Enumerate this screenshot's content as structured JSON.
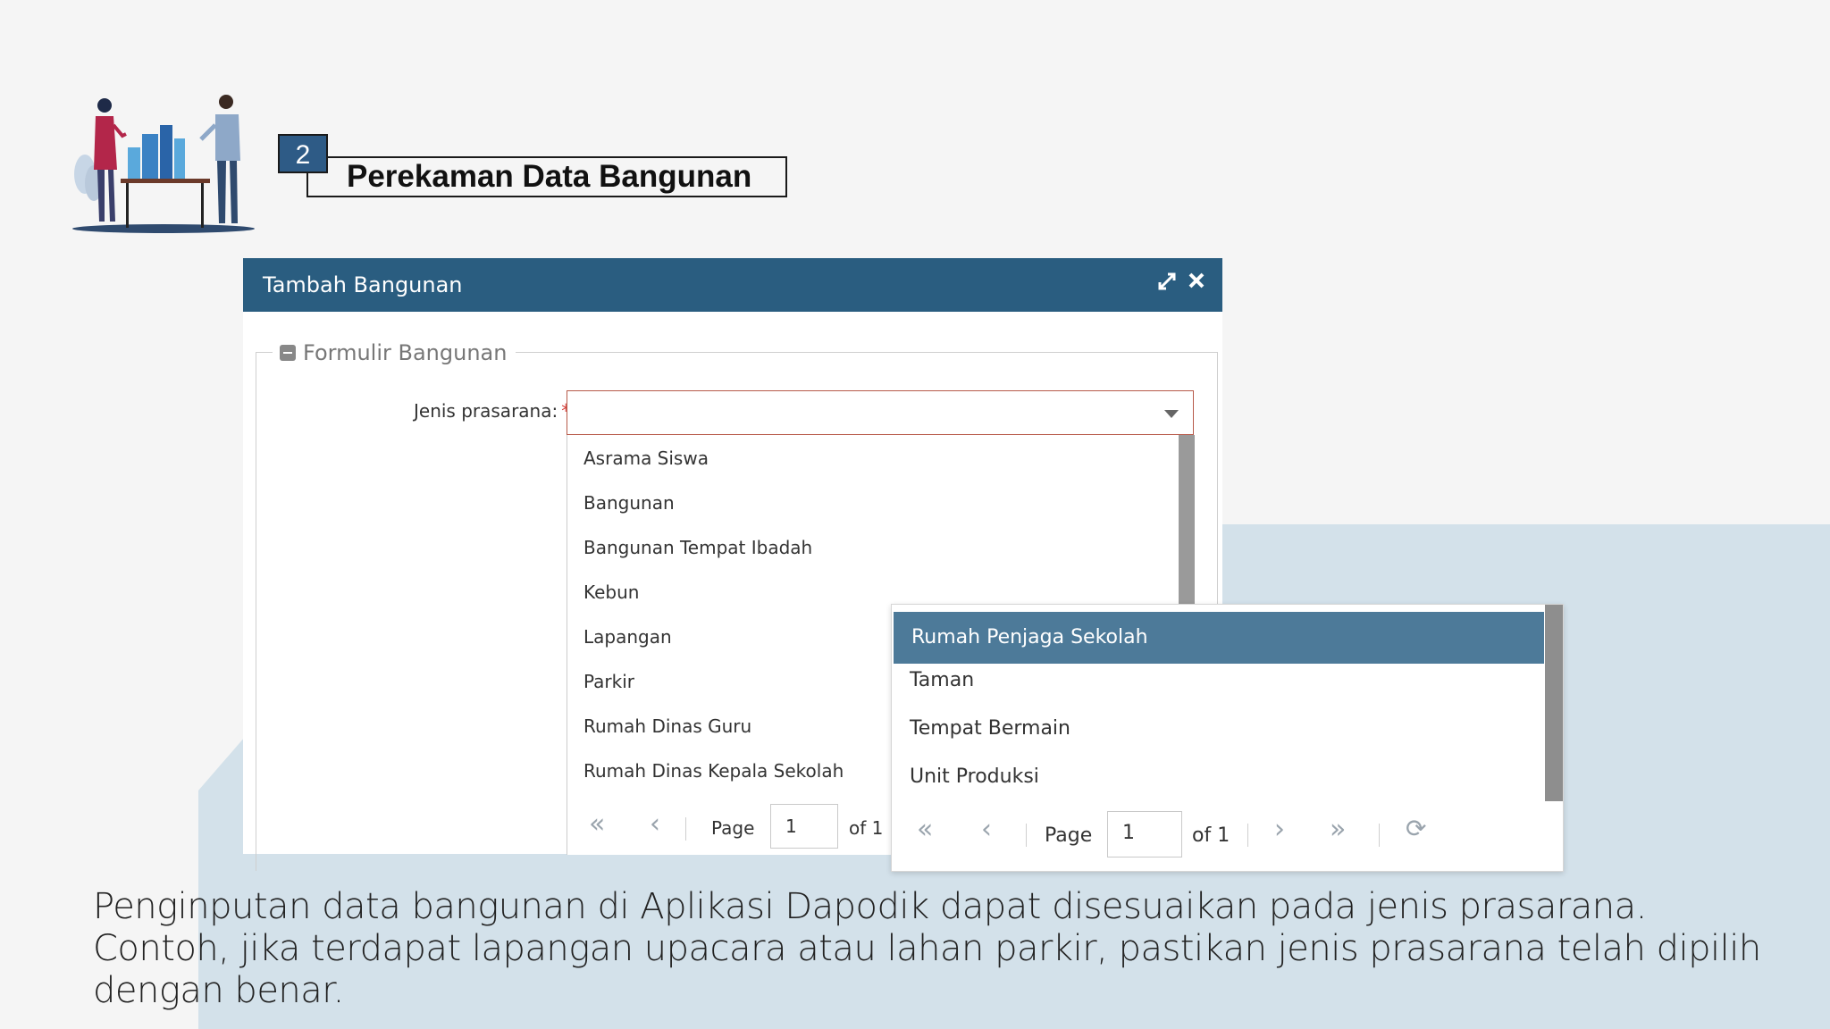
{
  "slide": {
    "step_number": "2",
    "title": "Perekaman Data Bangunan",
    "caption": "Penginputan data bangunan di Aplikasi Dapodik dapat disesuaikan pada jenis prasarana. Contoh, jika terdapat lapangan upacara atau lahan parkir, pastikan jenis prasarana telah dipilih dengan benar."
  },
  "dialog": {
    "title": "Tambah Bangunan",
    "icons": [
      "maximize-icon",
      "close-icon"
    ],
    "fieldset_legend": "Formulir Bangunan",
    "field": {
      "label": "Jenis prasarana:",
      "required_marker": "*",
      "value": ""
    }
  },
  "dropdown_list": {
    "items": [
      "Asrama Siswa",
      "Bangunan",
      "Bangunan Tempat Ibadah",
      "Kebun",
      "Lapangan",
      "Parkir",
      "Rumah Dinas Guru",
      "Rumah Dinas Kepala Sekolah"
    ],
    "pager": {
      "page_label": "Page",
      "page_value": "1",
      "of_label": "of 1"
    }
  },
  "dropdown_list_zoom": {
    "selected": "Rumah Penjaga Sekolah",
    "items": [
      "Taman",
      "Tempat Bermain",
      "Unit Produksi"
    ],
    "pager": {
      "page_label": "Page",
      "page_value": "1",
      "of_label": "of 1"
    }
  },
  "colors": {
    "header": "#2a5d80",
    "selected_row": "#4d7a99",
    "badge": "#2e5b86",
    "background_band": "#d3e1ea"
  }
}
